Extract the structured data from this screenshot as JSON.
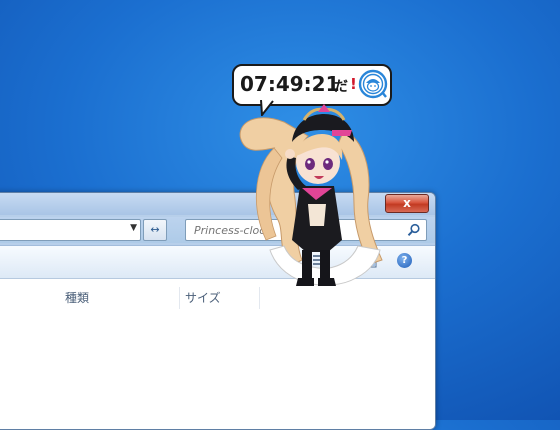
{
  "window": {
    "close_label": "x",
    "search": {
      "placeholder": "Princess-clock"
    },
    "address": {
      "dropdown_glyph": "▼"
    },
    "refresh_glyph": "↔",
    "help_glyph": "?",
    "columns": [
      "種類",
      "サイズ"
    ]
  },
  "clock": {
    "time": "07:49:21",
    "suffix": "だ",
    "exclaim": "!"
  },
  "colors": {
    "desktop_blue": "#1b6fd0",
    "close_red": "#c23a22",
    "accent_red": "#d2182b"
  },
  "icons": [
    "search-icon",
    "view-icon",
    "preview-pane-icon",
    "help-icon",
    "clock-logo-icon",
    "mascot"
  ]
}
